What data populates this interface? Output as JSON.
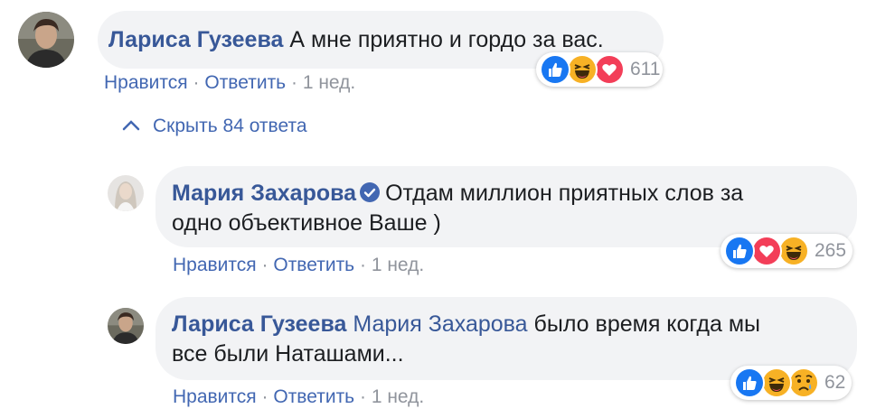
{
  "comments": [
    {
      "author": "Лариса Гузеева",
      "text": "А мне приятно и гордо за вас.",
      "actions": {
        "like": "Нравится",
        "reply": "Ответить",
        "sep": "·",
        "time": "1 нед."
      },
      "reactions": {
        "icons": [
          "like-icon",
          "haha-icon",
          "love-icon"
        ],
        "count": "611"
      }
    }
  ],
  "hide_replies": {
    "label": "Скрыть 84 ответа",
    "icon": "chevron-up-icon"
  },
  "replies": [
    {
      "author": "Мария Захарова",
      "verified": true,
      "text_line1": "Отдам миллион приятных слов за",
      "text_line2": "одно объективное Ваше )",
      "actions": {
        "like": "Нравится",
        "reply": "Ответить",
        "sep": "·",
        "time": "1 нед."
      },
      "reactions": {
        "icons": [
          "like-icon",
          "love-icon",
          "haha-icon"
        ],
        "count": "265"
      }
    },
    {
      "author": "Лариса Гузеева",
      "mention": "Мария Захарова",
      "text_line1": "было время когда мы",
      "text_line2": "все были Наташами...",
      "actions": {
        "like": "Нравится",
        "reply": "Ответить",
        "sep": "·",
        "time": "1 нед."
      },
      "reactions": {
        "icons": [
          "like-icon",
          "haha-icon",
          "sad-icon"
        ],
        "count": "62"
      }
    }
  ],
  "colors": {
    "link": "#4267b2",
    "author": "#385898",
    "meta": "#90949c",
    "bubble": "#f2f3f5",
    "like": "#1877f2",
    "love": "#f33e58",
    "haha": "#f7b125"
  }
}
